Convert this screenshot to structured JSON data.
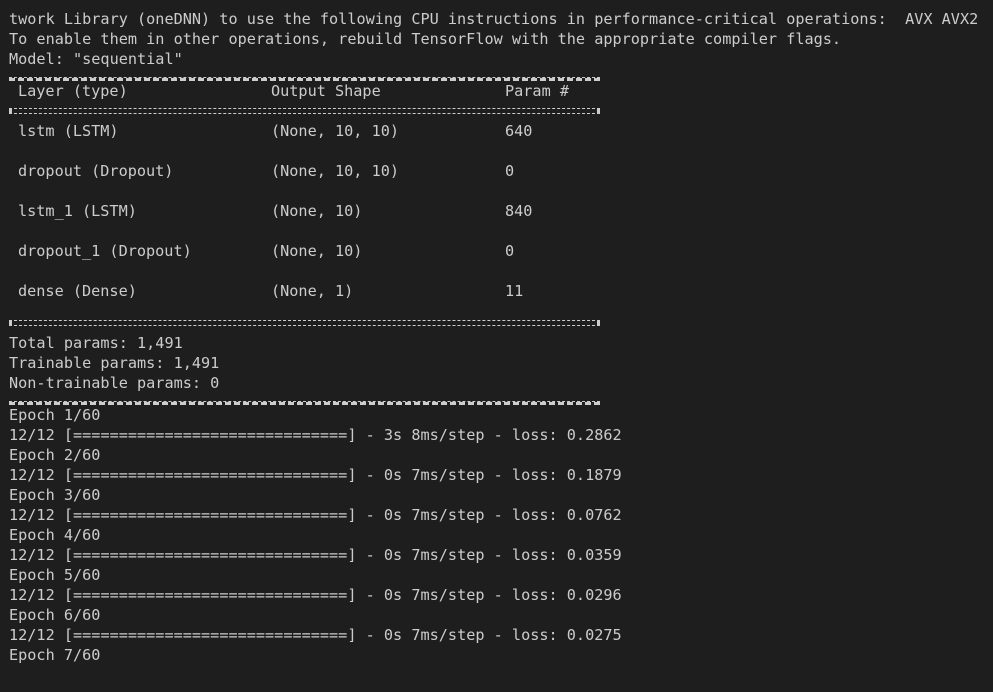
{
  "terminal": {
    "warning_line_1": "twork Library (oneDNN) to use the following CPU instructions in performance-critical operations:  AVX AVX2",
    "warning_line_2": "To enable them in other operations, rebuild TensorFlow with the appropriate compiler flags.",
    "model_line": "Model: \"sequential\"",
    "table": {
      "headers": {
        "layer": "Layer (type)",
        "output_shape": "Output Shape",
        "params": "Param #"
      },
      "rows": [
        {
          "layer": "lstm (LSTM)",
          "output_shape": "(None, 10, 10)",
          "params": "640"
        },
        {
          "layer": "dropout (Dropout)",
          "output_shape": "(None, 10, 10)",
          "params": "0"
        },
        {
          "layer": "lstm_1 (LSTM)",
          "output_shape": "(None, 10)",
          "params": "840"
        },
        {
          "layer": "dropout_1 (Dropout)",
          "output_shape": "(None, 10)",
          "params": "0"
        },
        {
          "layer": "dense (Dense)",
          "output_shape": "(None, 1)",
          "params": "11"
        }
      ]
    },
    "summary": {
      "total": "Total params: 1,491",
      "trainable": "Trainable params: 1,491",
      "non_trainable": "Non-trainable params: 0"
    },
    "epochs": [
      {
        "label": "Epoch 1/60",
        "steps": "12/12",
        "bar": "[==============================]",
        "stats": " - 3s 8ms/step - loss: 0.2862"
      },
      {
        "label": "Epoch 2/60",
        "steps": "12/12",
        "bar": "[==============================]",
        "stats": " - 0s 7ms/step - loss: 0.1879"
      },
      {
        "label": "Epoch 3/60",
        "steps": "12/12",
        "bar": "[==============================]",
        "stats": " - 0s 7ms/step - loss: 0.0762"
      },
      {
        "label": "Epoch 4/60",
        "steps": "12/12",
        "bar": "[==============================]",
        "stats": " - 0s 7ms/step - loss: 0.0359"
      },
      {
        "label": "Epoch 5/60",
        "steps": "12/12",
        "bar": "[==============================]",
        "stats": " - 0s 7ms/step - loss: 0.0296"
      },
      {
        "label": "Epoch 6/60",
        "steps": "12/12",
        "bar": "[==============================]",
        "stats": " - 0s 7ms/step - loss: 0.0275"
      }
    ],
    "last_epoch_label": "Epoch 7/60"
  },
  "colors": {
    "background": "#1e1e1e",
    "text": "#cccccc"
  }
}
